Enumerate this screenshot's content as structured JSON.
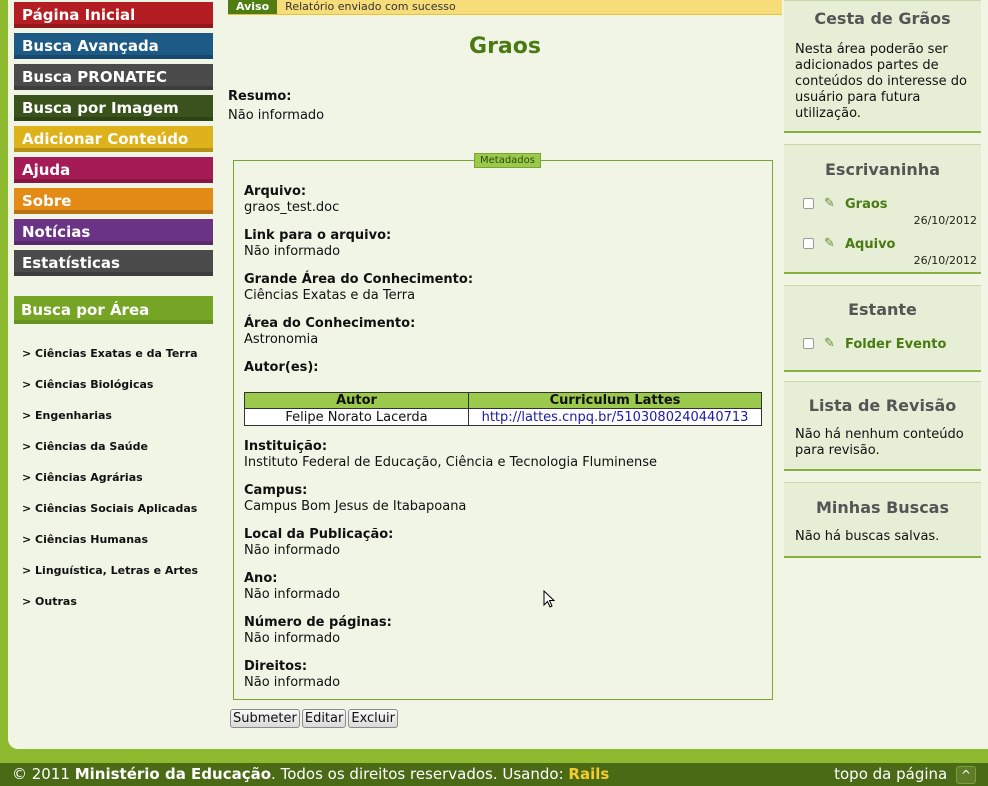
{
  "menu": [
    {
      "label": "Página Inicial",
      "color": "#b41d22"
    },
    {
      "label": "Busca Avançada",
      "color": "#1d5a86"
    },
    {
      "label": "Busca PRONATEC",
      "color": "#4b4b4b"
    },
    {
      "label": "Busca por Imagem",
      "color": "#3a531c"
    },
    {
      "label": "Adicionar Conteúdo",
      "color": "#ddb21b"
    },
    {
      "label": "Ajuda",
      "color": "#a51b55"
    },
    {
      "label": "Sobre",
      "color": "#e38a17"
    },
    {
      "label": "Notícias",
      "color": "#6b3386"
    },
    {
      "label": "Estatísticas",
      "color": "#4b4b4b"
    }
  ],
  "area": {
    "title": "Busca por Área",
    "items": [
      "> Ciências Exatas e da Terra",
      "> Ciências Biológicas",
      "> Engenharias",
      "> Ciências da Saúde",
      "> Ciências Agrárias",
      "> Ciências Sociais Aplicadas",
      "> Ciências Humanas",
      "> Linguística, Letras e Artes",
      "> Outras"
    ]
  },
  "alert": {
    "tag": "Aviso",
    "message": "Relatório enviado com sucesso"
  },
  "content": {
    "title": "Graos",
    "resumo_label": "Resumo:",
    "resumo_value": "Não informado",
    "legend": "Metadados",
    "fields": [
      {
        "label": "Arquivo:",
        "value": "graos_test.doc"
      },
      {
        "label": "Link para o arquivo:",
        "value": "Não informado"
      },
      {
        "label": "Grande Área do Conhecimento:",
        "value": "Ciências Exatas e da Terra"
      },
      {
        "label": "Área do Conhecimento:",
        "value": "Astronomia"
      },
      {
        "label": "Autor(es):",
        "value": ""
      }
    ],
    "authors_headers": [
      "Autor",
      "Curriculum Lattes"
    ],
    "authors_rows": [
      [
        "Felipe Norato Lacerda",
        "http://lattes.cnpq.br/5103080240440713"
      ]
    ],
    "fields2": [
      {
        "label": "Instituição:",
        "value": "Instituto Federal de Educação, Ciência e Tecnologia Fluminense"
      },
      {
        "label": "Campus:",
        "value": "Campus Bom Jesus de Itabapoana"
      },
      {
        "label": "Local da Publicação:",
        "value": "Não informado"
      },
      {
        "label": "Ano:",
        "value": "Não informado"
      },
      {
        "label": "Número de páginas:",
        "value": "Não informado"
      },
      {
        "label": "Direitos:",
        "value": "Não informado"
      }
    ],
    "buttons": [
      "Submeter",
      "Editar",
      "Excluir"
    ]
  },
  "sidebar": {
    "cesta": {
      "title": "Cesta de Grãos",
      "text": "Nesta área poderão ser adicionados partes de conteúdos do interesse do usuário para futura utilização."
    },
    "escrivaninha": {
      "title": "Escrivaninha",
      "items": [
        {
          "name": "Graos",
          "date": "26/10/2012"
        },
        {
          "name": "Aquivo",
          "date": "26/10/2012"
        }
      ]
    },
    "estante": {
      "title": "Estante",
      "items": [
        {
          "name": "Folder Evento"
        }
      ]
    },
    "revisao": {
      "title": "Lista de Revisão",
      "text": "Não há nenhum conteúdo para revisão."
    },
    "buscas": {
      "title": "Minhas Buscas",
      "text": "Não há buscas salvas."
    }
  },
  "footer": {
    "copyright": "© 2011",
    "org": "Ministério da Educação",
    "rights": ". Todos os direitos reservados. Usando:",
    "rails": "Rails",
    "top_link": "topo da página",
    "top_icon": "chevron-up-icon"
  }
}
